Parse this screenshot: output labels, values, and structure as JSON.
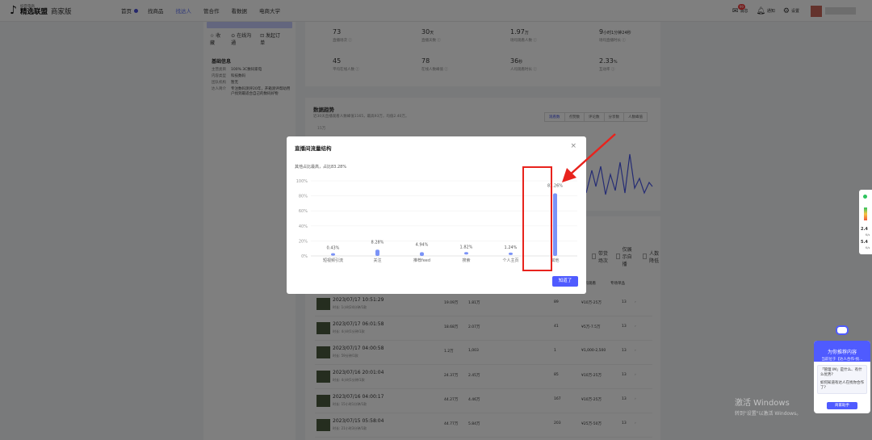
{
  "header": {
    "logo_small": "抖音电商",
    "logo_main": "精选联盟",
    "logo_sub": "商家版",
    "nav": [
      "首页",
      "找商品",
      "找达人",
      "管合作",
      "看数据",
      "电商大学"
    ],
    "nav_active_index": 2,
    "right": {
      "message_label": "消息",
      "message_badge": "99",
      "notify_label": "通知",
      "settings_label": "设置"
    }
  },
  "left_panel": {
    "actions": {
      "collect": "☆ 收藏",
      "invite": "⊙ 在线沟通",
      "order": "⊡ 发起订单"
    },
    "section_title": "基础信息",
    "info": [
      {
        "k": "主营类目",
        "v": "100% 3C数码家电"
      },
      {
        "k": "内容类型",
        "v": "科技数码"
      },
      {
        "k": "团队机构",
        "v": "暂无"
      },
      {
        "k": "达人简介",
        "v": "专注数码测评20年，开箱测评帮助用户找到最适合自己的数码好物"
      }
    ]
  },
  "stats": [
    {
      "value": "73",
      "unit": "",
      "label": "直播场次 ⓘ"
    },
    {
      "value": "30",
      "unit": "天",
      "label": "直播天数 ⓘ"
    },
    {
      "value": "1.97",
      "unit": "万",
      "label": "场均观看人数 ⓘ"
    },
    {
      "value": "9",
      "unit": "小时1分钟24秒",
      "label": "场均直播时长 ⓘ"
    },
    {
      "value": "45",
      "unit": "",
      "label": "平均在线人数 ⓘ"
    },
    {
      "value": "78",
      "unit": "",
      "label": "在线人数峰值 ⓘ"
    },
    {
      "value": "36",
      "unit": "秒",
      "label": "人均观看时长 ⓘ"
    },
    {
      "value": "2.33",
      "unit": "%",
      "label": "互动率 ⓘ"
    }
  ],
  "trend": {
    "title": "数据趋势",
    "desc": "近30天直播观看人数峰值1165，最高93万，均值2.40万。",
    "tabs": [
      "观看数",
      "点赞数",
      "评论数",
      "分享数",
      "人数峰值"
    ],
    "active_tab": 0,
    "y_top": "15万"
  },
  "filters": [
    "带货场次",
    "仅展示自播",
    "人数降低"
  ],
  "table": {
    "headers": [
      "场均观看",
      "专场单品"
    ],
    "rows": [
      {
        "date": "2023/07/17 10:51:29",
        "sub": "时长: 1小时24分钟/1款",
        "views": "19.09万",
        "gmv": "1.81万",
        "n": "89",
        "price": "¥10万-25万",
        "items": "13"
      },
      {
        "date": "2023/07/17 06:01:58",
        "sub": "时长: 4小时1分钟/1款",
        "views": "18.68万",
        "gmv": "2.07万",
        "n": "41",
        "price": "¥5万-7.5万",
        "items": "13"
      },
      {
        "date": "2023/07/17 04:00:58",
        "sub": "时长: 59分钟/1款",
        "views": "1.2万",
        "gmv": "1,003",
        "n": "1",
        "price": "¥1,000-2,500",
        "items": "13"
      },
      {
        "date": "2023/07/16 20:01:04",
        "sub": "时长: 4小时1分钟/1款",
        "views": "24.37万",
        "gmv": "2.45万",
        "n": "85",
        "price": "¥10万-25万",
        "items": "13"
      },
      {
        "date": "2023/07/16 04:00:17",
        "sub": "时长: 15小时1分钟/1款",
        "views": "44.27万",
        "gmv": "4.46万",
        "n": "167",
        "price": "¥10万-25万",
        "items": "13"
      },
      {
        "date": "2023/07/15 05:58:04",
        "sub": "时长: 21小时3分钟/1款",
        "views": "44.77万",
        "gmv": "5.84万",
        "n": "203",
        "price": "¥25万-50万",
        "items": "13"
      }
    ]
  },
  "modal": {
    "title": "直播间流量结构",
    "close": "×",
    "note": "其他占比最高，占比83.28%",
    "ok_label": "知道了"
  },
  "chart_data": {
    "type": "bar",
    "title": "直播间流量结构",
    "categories": [
      "短视频引流",
      "关注",
      "推荐feed",
      "搜索",
      "个人主页",
      "其他"
    ],
    "values": [
      0.43,
      8.28,
      4.94,
      1.82,
      1.24,
      83.28
    ],
    "value_labels": [
      "0.43%",
      "8.28%",
      "4.94%",
      "1.82%",
      "1.24%",
      "83.26%"
    ],
    "y_ticks": [
      "100%",
      "80%",
      "60%",
      "40%",
      "20%",
      "0%"
    ],
    "ylim": [
      0,
      100
    ],
    "grid": true,
    "bar_color": "#7b93f7",
    "highlight_color": "#e8231d"
  },
  "watermark": {
    "title": "激活 Windows",
    "sub": "转到\"设置\"以激活 Windows。"
  },
  "side_widget": {
    "v1": "2.4",
    "u1": "K/s",
    "v2": "5.4",
    "u2": "K/s"
  },
  "assistant": {
    "title": "为你推荐内容",
    "sub": "当前位于【达人合作-找…",
    "q1": "「管理 IM」是什么、有什么优势?",
    "q2": "如何知道有达人在找你合作了?",
    "button": "商家助手"
  }
}
